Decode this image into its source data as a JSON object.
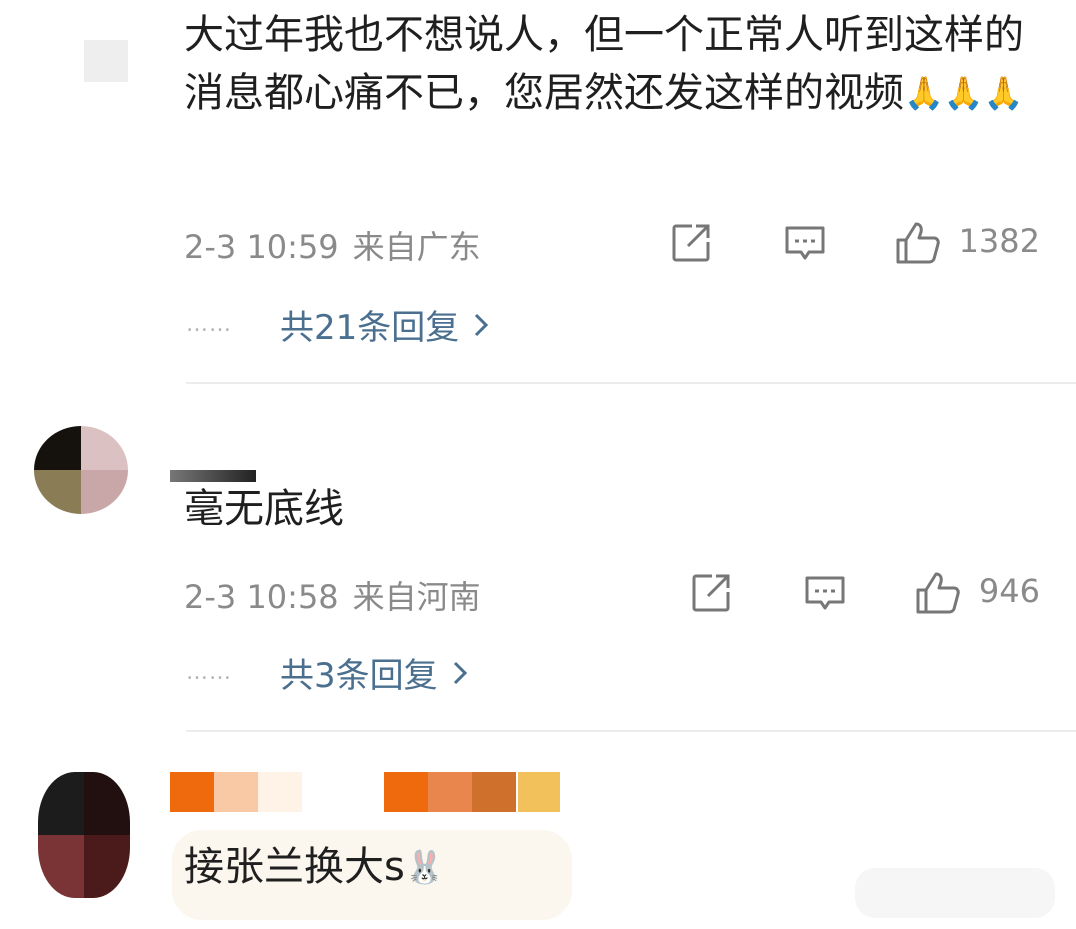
{
  "comments": [
    {
      "text": "大过年我也不想说人，但一个正常人听到这样的消息都心痛不已，您居然还发这样的视频",
      "emoji": "🙏🙏🙏",
      "time": "2-3 10:59",
      "location": "来自广东",
      "likes": "1382",
      "replies": "共21条回复",
      "avatar_colors": [
        "#8aa36e",
        "#b8a0b8",
        "#ececec",
        "#ffffff"
      ]
    },
    {
      "text": "毫无底线",
      "time": "2-3 10:58",
      "location": "来自河南",
      "likes": "946",
      "replies": "共3条回复",
      "avatar_colors": [
        "#15110d",
        "#dcc1c2",
        "#8a7c55",
        "#c9a7a8"
      ]
    },
    {
      "text": "接张兰换大s",
      "emoji": "🐰",
      "avatar_colors": [
        "#1c1c1c",
        "#220f10",
        "#7b3435",
        "#4a1b1a"
      ],
      "name_colors": [
        "#ee6a0c",
        "#f9c8a5",
        "#fff2e6",
        "#ffffff",
        "#ee6a0c",
        "#e8864d",
        "#d0702d"
      ]
    }
  ],
  "reply_dots": "……",
  "icons": {
    "share": "share-icon",
    "comment": "comment-icon",
    "like": "thumbs-up-icon",
    "chevron": "chevron-right-icon"
  },
  "colors": {
    "meta_gray": "#8a8a8a",
    "link_blue": "#4a6f8f",
    "divider": "#ececec"
  }
}
